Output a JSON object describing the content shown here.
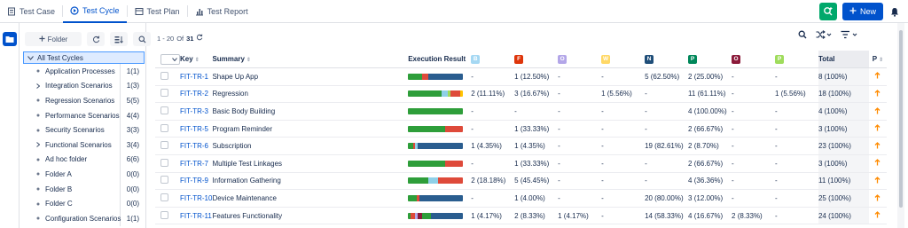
{
  "tabs": [
    {
      "label": "Test Case",
      "icon": "test-case-icon"
    },
    {
      "label": "Test Cycle",
      "icon": "test-cycle-icon",
      "active": true
    },
    {
      "label": "Test Plan",
      "icon": "test-plan-icon"
    },
    {
      "label": "Test Report",
      "icon": "test-report-icon"
    }
  ],
  "top": {
    "new_label": "New"
  },
  "sidebar": {
    "folder_label": "Folder",
    "all_label": "All Test Cycles",
    "items": [
      {
        "label": "Application Processes",
        "count": "1(1)",
        "mark": "dot"
      },
      {
        "label": "Integration Scenarios",
        "count": "1(3)",
        "mark": "chevron"
      },
      {
        "label": "Regression Scenarios",
        "count": "5(5)",
        "mark": "dot"
      },
      {
        "label": "Performance Scenarios",
        "count": "4(4)",
        "mark": "dot"
      },
      {
        "label": "Security Scenarios",
        "count": "3(3)",
        "mark": "dot"
      },
      {
        "label": "Functional Scenarios",
        "count": "3(4)",
        "mark": "chevron"
      },
      {
        "label": "Ad hoc folder",
        "count": "6(6)",
        "mark": "dot"
      },
      {
        "label": "Folder A",
        "count": "0(0)",
        "mark": "dot"
      },
      {
        "label": "Folder B",
        "count": "0(0)",
        "mark": "dot"
      },
      {
        "label": "Folder C",
        "count": "0(0)",
        "mark": "dot"
      },
      {
        "label": "Configuration Scenarios",
        "count": "1(1)",
        "mark": "dot"
      }
    ]
  },
  "pager": {
    "range": "1 - 20",
    "of": "Of",
    "total": "31"
  },
  "table": {
    "headers": {
      "key": "Key",
      "summary": "Summary",
      "exec": "Execution Result",
      "total": "Total",
      "p": "P"
    },
    "statuses": [
      {
        "letter": "B",
        "color": "#a5d8f3"
      },
      {
        "letter": "F",
        "color": "#de350b"
      },
      {
        "letter": "O",
        "color": "#b3a6e8"
      },
      {
        "letter": "W",
        "color": "#ffd866"
      },
      {
        "letter": "N",
        "color": "#1f4e79"
      },
      {
        "letter": "P",
        "color": "#00875a"
      },
      {
        "letter": "O",
        "color": "#8b1a3a"
      },
      {
        "letter": "P",
        "color": "#9fdc5c"
      }
    ],
    "rows": [
      {
        "key": "FIT-TR-1",
        "summary": "Shape Up App",
        "bar": [
          {
            "v": 25,
            "c": "#2e9e3a"
          },
          {
            "v": 12.5,
            "c": "#de4a3a"
          },
          {
            "v": 62.5,
            "c": "#2a5d8f"
          }
        ],
        "cols": [
          "-",
          "1 (12.50%)",
          "-",
          "-",
          "5 (62.50%)",
          "2 (25.00%)",
          "-",
          "-"
        ],
        "total": "8 (100%)"
      },
      {
        "key": "FIT-TR-2",
        "summary": "Regression",
        "bar": [
          {
            "v": 61.11,
            "c": "#2e9e3a"
          },
          {
            "v": 11.11,
            "c": "#8fd0e8"
          },
          {
            "v": 5.56,
            "c": "#9fdc5c"
          },
          {
            "v": 16.67,
            "c": "#de4a3a"
          },
          {
            "v": 5.56,
            "c": "#ffc400"
          }
        ],
        "cols": [
          "2 (11.11%)",
          "3 (16.67%)",
          "-",
          "1 (5.56%)",
          "-",
          "11 (61.11%)",
          "-",
          "1 (5.56%)"
        ],
        "total": "18 (100%)"
      },
      {
        "key": "FIT-TR-3",
        "summary": "Basic Body Building",
        "bar": [
          {
            "v": 100,
            "c": "#2e9e3a"
          }
        ],
        "cols": [
          "-",
          "-",
          "-",
          "-",
          "-",
          "4 (100.00%)",
          "-",
          "-"
        ],
        "total": "4 (100%)"
      },
      {
        "key": "FIT-TR-5",
        "summary": "Program Reminder",
        "bar": [
          {
            "v": 66.67,
            "c": "#2e9e3a"
          },
          {
            "v": 33.33,
            "c": "#de4a3a"
          }
        ],
        "cols": [
          "-",
          "1 (33.33%)",
          "-",
          "-",
          "-",
          "2 (66.67%)",
          "-",
          "-"
        ],
        "total": "3 (100%)"
      },
      {
        "key": "FIT-TR-6",
        "summary": "Subscription",
        "bar": [
          {
            "v": 8.7,
            "c": "#2e9e3a"
          },
          {
            "v": 4.35,
            "c": "#de4a3a"
          },
          {
            "v": 4.35,
            "c": "#8fd0e8"
          },
          {
            "v": 82.61,
            "c": "#2a5d8f"
          }
        ],
        "cols": [
          "1 (4.35%)",
          "1 (4.35%)",
          "-",
          "-",
          "19 (82.61%)",
          "2 (8.70%)",
          "-",
          "-"
        ],
        "total": "23 (100%)"
      },
      {
        "key": "FIT-TR-7",
        "summary": "Multiple Test Linkages",
        "bar": [
          {
            "v": 66.67,
            "c": "#2e9e3a"
          },
          {
            "v": 33.33,
            "c": "#de4a3a"
          }
        ],
        "cols": [
          "-",
          "1 (33.33%)",
          "-",
          "-",
          "-",
          "2 (66.67%)",
          "-",
          "-"
        ],
        "total": "3 (100%)"
      },
      {
        "key": "FIT-TR-9",
        "summary": "Information Gathering",
        "bar": [
          {
            "v": 36.36,
            "c": "#2e9e3a"
          },
          {
            "v": 18.18,
            "c": "#8fd0e8"
          },
          {
            "v": 45.45,
            "c": "#de4a3a"
          }
        ],
        "cols": [
          "2 (18.18%)",
          "5 (45.45%)",
          "-",
          "-",
          "-",
          "4 (36.36%)",
          "-",
          "-"
        ],
        "total": "11 (100%)"
      },
      {
        "key": "FIT-TR-10",
        "summary": "Device Maintenance",
        "bar": [
          {
            "v": 15,
            "c": "#2e9e3a"
          },
          {
            "v": 5,
            "c": "#de4a3a"
          },
          {
            "v": 80,
            "c": "#2a5d8f"
          }
        ],
        "cols": [
          "-",
          "1 (4.00%)",
          "-",
          "-",
          "20 (80.00%)",
          "3 (12.00%)",
          "-",
          "-"
        ],
        "total": "25 (100%)"
      },
      {
        "key": "FIT-TR-11",
        "summary": "Features Functionality",
        "bar": [
          {
            "v": 4.17,
            "c": "#2e9e3a"
          },
          {
            "v": 8.33,
            "c": "#de4a3a"
          },
          {
            "v": 4.17,
            "c": "#b3a6e8"
          },
          {
            "v": 8.33,
            "c": "#8b1a3a"
          },
          {
            "v": 16.67,
            "c": "#2e9e3a"
          },
          {
            "v": 58.33,
            "c": "#2a5d8f"
          }
        ],
        "cols": [
          "1 (4.17%)",
          "2 (8.33%)",
          "1 (4.17%)",
          "-",
          "14 (58.33%)",
          "4 (16.67%)",
          "2 (8.33%)",
          "-"
        ],
        "total": "24 (100%)"
      }
    ]
  }
}
